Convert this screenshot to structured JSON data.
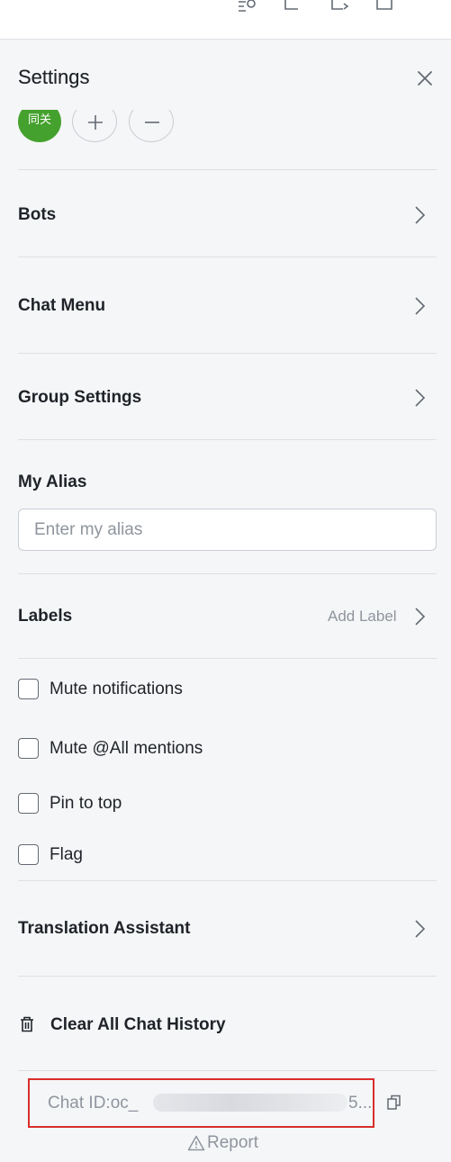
{
  "header": {
    "title": "Settings"
  },
  "avatar": {
    "text": "同关"
  },
  "rows": {
    "bots": "Bots",
    "chat_menu": "Chat Menu",
    "group_settings": "Group Settings",
    "my_alias": "My Alias",
    "labels": "Labels",
    "translation_assistant": "Translation Assistant"
  },
  "alias": {
    "placeholder": "Enter my alias",
    "value": ""
  },
  "labels": {
    "add_label": "Add Label"
  },
  "checkboxes": [
    {
      "label": "Mute notifications",
      "checked": false
    },
    {
      "label": "Mute @All mentions",
      "checked": false
    },
    {
      "label": "Pin to top",
      "checked": false
    },
    {
      "label": "Flag",
      "checked": false
    }
  ],
  "clear_history": {
    "label": "Clear All Chat History"
  },
  "chat_id": {
    "prefix": "Chat ID:oc_",
    "suffix": "5..."
  },
  "report": {
    "label": "Report"
  },
  "colors": {
    "highlight_box": "#d92e2b",
    "avatar_bg": "#45a12e",
    "panel_bg": "#f5f6f7"
  }
}
